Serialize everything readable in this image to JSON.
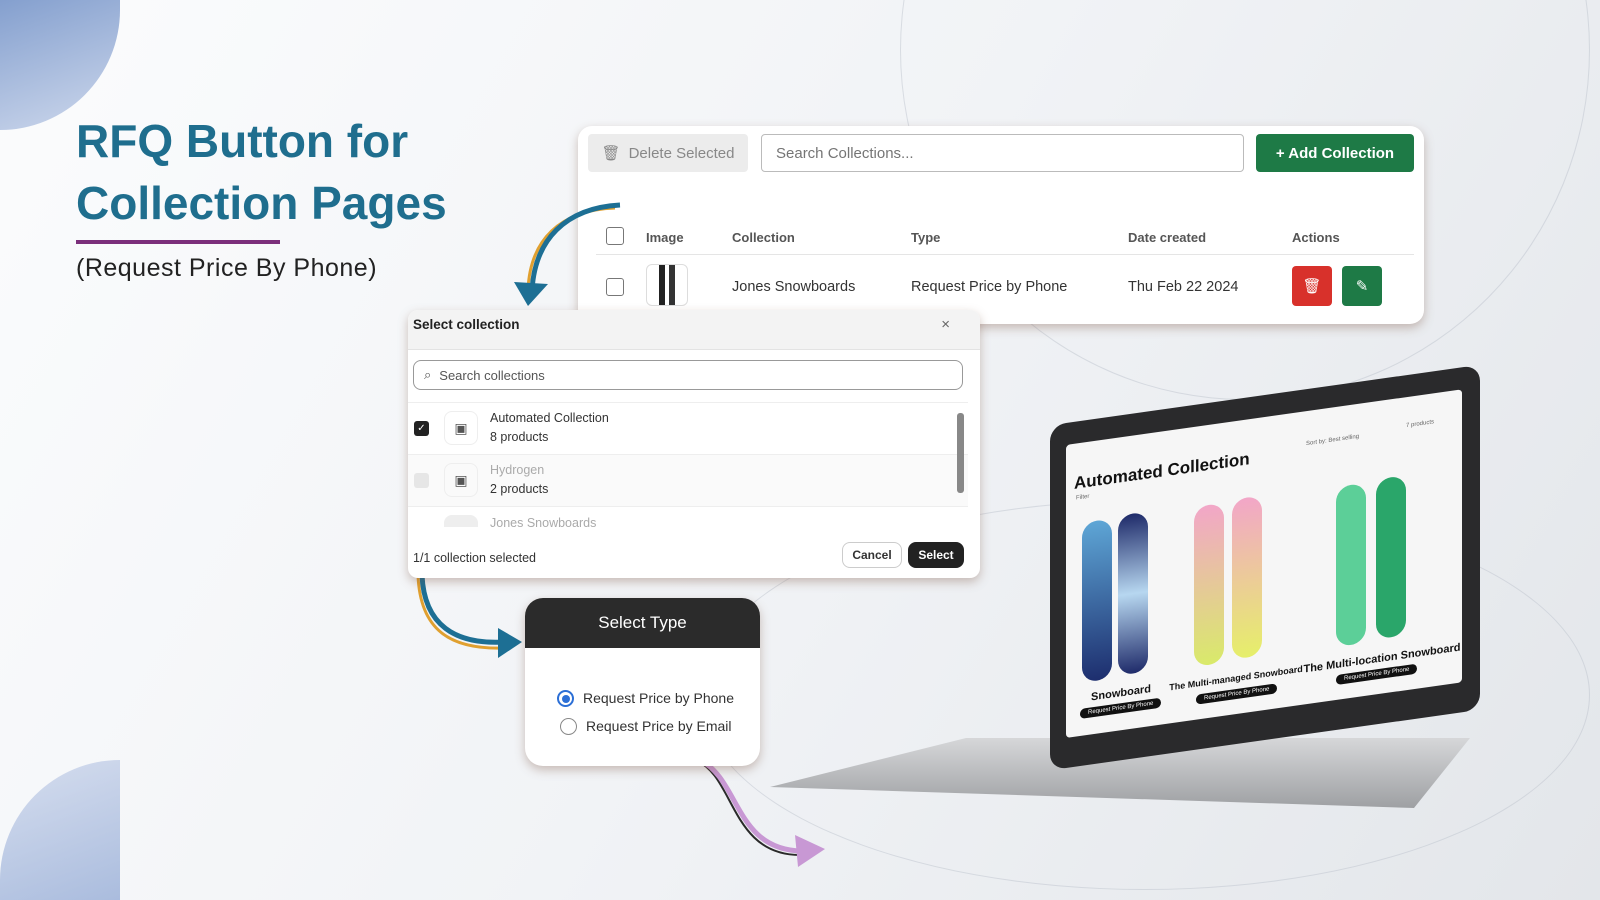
{
  "hero": {
    "title_line1": "RFQ Button for",
    "title_line2": "Collection Pages",
    "subtitle": "(Request Price By Phone)"
  },
  "colors": {
    "title": "#1f6e8e",
    "underline": "#7b2f7b",
    "add_button": "#1e7a46",
    "delete_icon_button": "#d8312b",
    "edit_button": "#1e7a46"
  },
  "collections_table": {
    "delete_selected": "Delete Selected",
    "search_placeholder": "Search Collections...",
    "add_collection": "+ Add Collection",
    "headers": [
      "Image",
      "Collection",
      "Type",
      "Date created",
      "Actions"
    ],
    "rows": [
      {
        "collection": "Jones Snowboards",
        "type": "Request Price by Phone",
        "date": "Thu Feb 22 2024"
      }
    ]
  },
  "select_modal": {
    "title": "Select collection",
    "search_placeholder": "Search collections",
    "items": [
      {
        "name": "Automated Collection",
        "count": "8 products",
        "checked": true
      },
      {
        "name": "Hydrogen",
        "count": "2 products",
        "checked": false
      },
      {
        "name": "Jones Snowboards",
        "count": "",
        "checked": false
      }
    ],
    "status": "1/1 collection selected",
    "cancel": "Cancel",
    "select": "Select"
  },
  "select_type": {
    "title": "Select Type",
    "options": [
      {
        "label": "Request Price by Phone",
        "selected": true
      },
      {
        "label": "Request Price by Email",
        "selected": false
      }
    ]
  },
  "laptop": {
    "heading": "Automated Collection",
    "filter": "Filter",
    "sort_label": "Sort by:",
    "sort_value": "Best selling",
    "count": "7 products",
    "products": [
      {
        "name": "Snowboard",
        "button": "Request Price By Phone"
      },
      {
        "name": "The Multi-managed Snowboard",
        "button": "Request Price By Phone"
      },
      {
        "name": "The Multi-location Snowboard",
        "button": "Request Price By Phone"
      }
    ]
  }
}
